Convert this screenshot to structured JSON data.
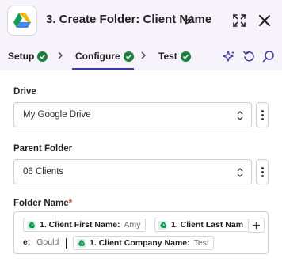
{
  "header": {
    "title": "3. Create Folder: Client Name",
    "app_icon": "google-drive-icon",
    "edit_icon": "pencil-icon",
    "expand_icon": "expand-icon",
    "close_icon": "close-icon"
  },
  "tabs": [
    {
      "label": "Setup",
      "status": "complete"
    },
    {
      "label": "Configure",
      "status": "complete",
      "active": true
    },
    {
      "label": "Test",
      "status": "complete"
    }
  ],
  "toolbar": {
    "icons": [
      "sparkle-icon",
      "refresh-icon",
      "search-icon"
    ]
  },
  "fields": {
    "drive": {
      "label": "Drive",
      "value": "My Google Drive"
    },
    "parent_folder": {
      "label": "Parent Folder",
      "value": "06 Clients"
    },
    "folder_name": {
      "label": "Folder Name",
      "required_mark": "*",
      "tokens": [
        {
          "key": "1. Client First Name:",
          "value": "Amy"
        },
        {
          "key": "1. Client Last Nam",
          "continued_key": "e:",
          "value": "Gould"
        },
        {
          "key": "1. Client Company Name:",
          "value": "Test"
        }
      ]
    }
  },
  "colors": {
    "accent": "#3b3aa8",
    "success": "#1d7f3b",
    "header_bg": "#f6f3fb",
    "required": "#d0382c"
  }
}
